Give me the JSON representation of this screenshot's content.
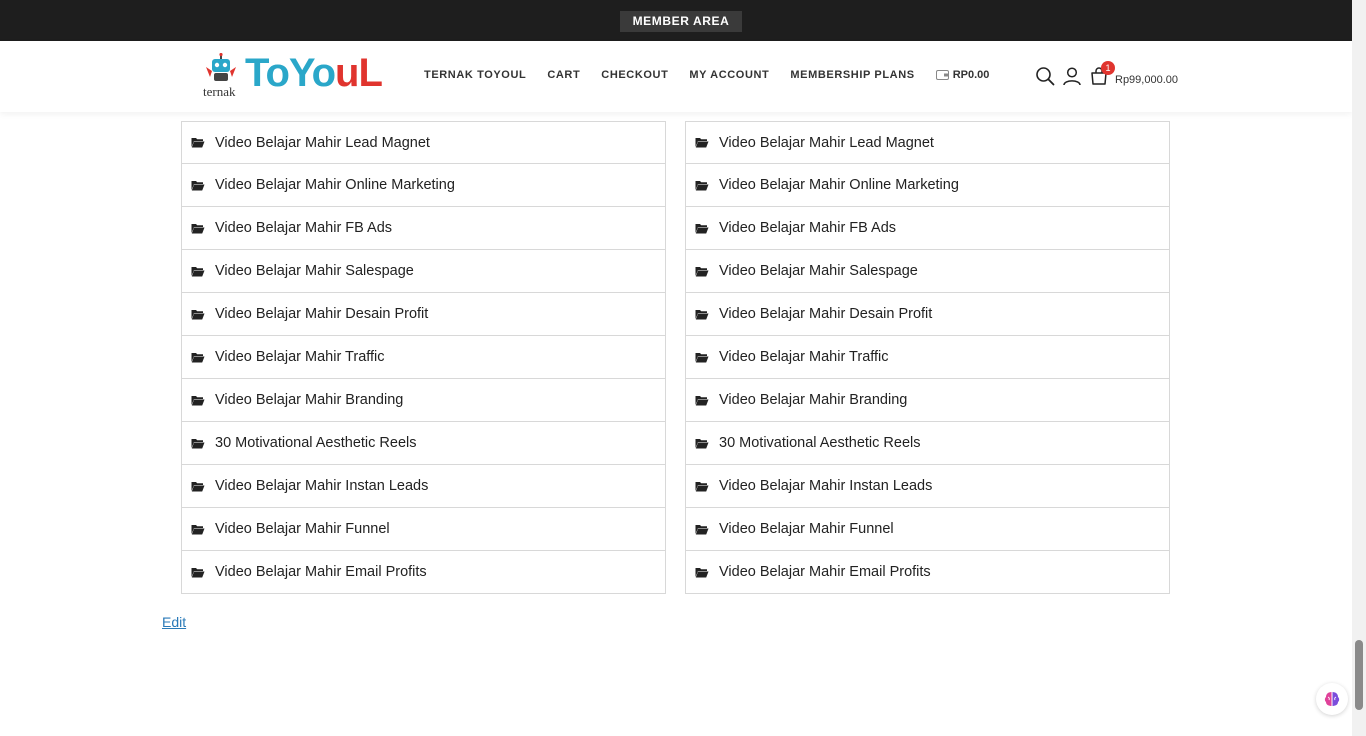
{
  "topbar": {
    "member_area": "MEMBER AREA"
  },
  "logo": {
    "small": "ternak",
    "big_blue": "ToYo",
    "big_red": "uL"
  },
  "nav": {
    "items": [
      "TERNAK TOYOUL",
      "CART",
      "CHECKOUT",
      "MY ACCOUNT",
      "MEMBERSHIP PLANS"
    ],
    "wallet": "RP0.00"
  },
  "cart": {
    "count": "1",
    "total": "Rp99,000.00"
  },
  "list_left": [
    "Video Belajar Mahir Lead Magnet",
    "Video Belajar Mahir Online Marketing",
    "Video Belajar Mahir FB Ads",
    "Video Belajar Mahir Salespage",
    "Video Belajar Mahir Desain Profit",
    "Video Belajar Mahir Traffic",
    "Video Belajar Mahir Branding",
    "30 Motivational Aesthetic Reels",
    "Video Belajar Mahir Instan Leads",
    "Video Belajar Mahir Funnel",
    "Video Belajar Mahir Email Profits"
  ],
  "list_right": [
    "Video Belajar Mahir Lead Magnet",
    "Video Belajar Mahir Online Marketing",
    "Video Belajar Mahir FB Ads",
    "Video Belajar Mahir Salespage",
    "Video Belajar Mahir Desain Profit",
    "Video Belajar Mahir Traffic",
    "Video Belajar Mahir Branding",
    "30 Motivational Aesthetic Reels",
    "Video Belajar Mahir Instan Leads",
    "Video Belajar Mahir Funnel",
    "Video Belajar Mahir Email Profits"
  ],
  "edit_link": "Edit",
  "colors": {
    "topbar": "#1e1e1e",
    "logo_blue": "#2aa7c9",
    "logo_red": "#e0342e",
    "link": "#2a7ab8"
  }
}
